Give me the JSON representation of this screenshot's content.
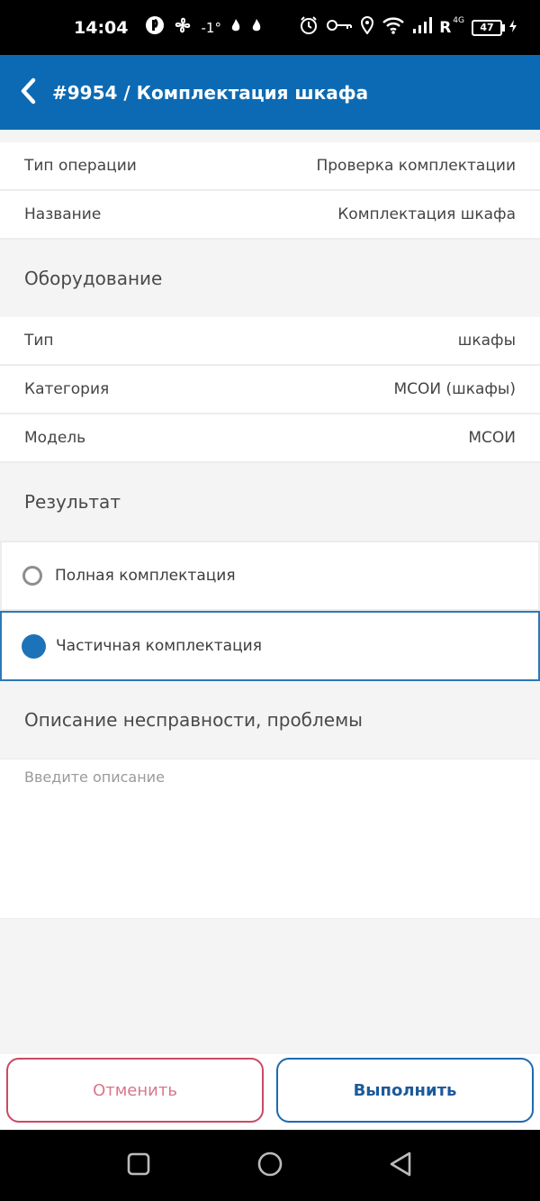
{
  "status_bar": {
    "time": "14:04",
    "temperature": "-1°",
    "network_badge": "R",
    "network_type": "4G",
    "battery": "47"
  },
  "app_bar": {
    "title": "#9954 / Комплектация шкафа",
    "back_icon": "chevron-left-icon",
    "background": "#0c6ab4"
  },
  "info": [
    {
      "label": "Тип операции",
      "value": "Проверка комплектации"
    },
    {
      "label": "Название",
      "value": "Комплектация шкафа"
    }
  ],
  "equipment": {
    "heading": "Оборудование",
    "rows": [
      {
        "label": "Тип",
        "value": "шкафы"
      },
      {
        "label": "Категория",
        "value": "МСОИ (шкафы)"
      },
      {
        "label": "Модель",
        "value": "МСОИ"
      }
    ]
  },
  "result": {
    "heading": "Результат",
    "options": [
      {
        "label": "Полная комплектация",
        "selected": false
      },
      {
        "label": "Частичная комплектация",
        "selected": true
      }
    ]
  },
  "description": {
    "heading": "Описание несправности, проблемы",
    "placeholder": "Введите описание",
    "value": ""
  },
  "actions": {
    "cancel_label": "Отменить",
    "submit_label": "Выполнить",
    "cancel_color": "#c94a63",
    "submit_color": "#1f6ab0"
  },
  "nav_bar": {
    "icons": [
      "recents-icon",
      "home-icon",
      "back-icon"
    ]
  }
}
